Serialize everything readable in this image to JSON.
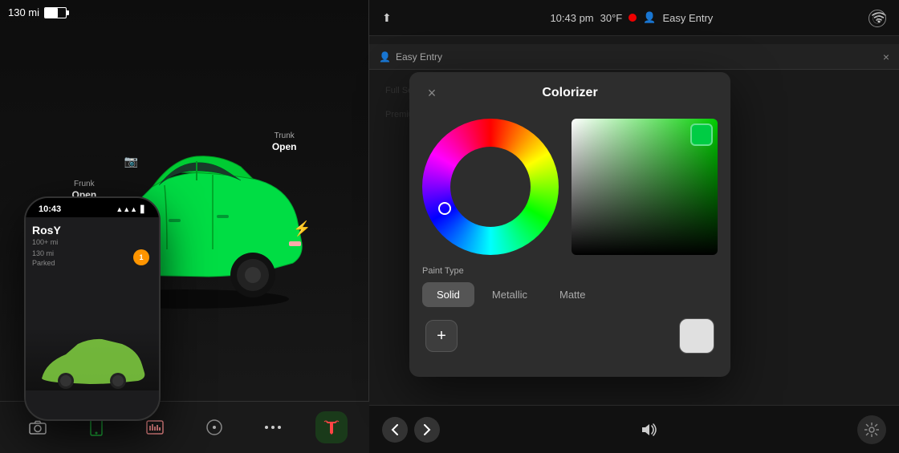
{
  "left_panel": {
    "status": {
      "mileage": "130 mi",
      "time": "10:43 pm",
      "temperature": "30°F",
      "mode": "Easy Entry"
    },
    "car_labels": {
      "frunk": {
        "line1": "Frunk",
        "line2": "Open"
      },
      "trunk": {
        "line1": "Trunk",
        "line2": "Open"
      }
    },
    "taskbar_icons": [
      "📷",
      "📞",
      "🎵",
      "🔵",
      "⋯",
      "🏮",
      "⚙"
    ]
  },
  "phone": {
    "time": "10:43",
    "app_name": "RosY",
    "subtitle": "100+ mi",
    "status": "Parked",
    "notification": "1"
  },
  "right_panel": {
    "status_bar": {
      "time": "10:43 pm",
      "temperature": "30°F",
      "mode_label": "Easy Entry"
    },
    "easy_entry_banner": {
      "person_label": "Easy Entry",
      "close_label": "×"
    },
    "colorizer": {
      "title": "Colorizer",
      "close_label": "×",
      "paint_type_label": "Paint Type",
      "paint_types": [
        "Solid",
        "Metallic",
        "Matte"
      ],
      "active_paint": "Solid",
      "add_button_label": "+",
      "selected_color": "#00cc44"
    },
    "bottom_bar": {
      "back_label": "<",
      "forward_label": ">",
      "volume_icon": "🔊"
    }
  }
}
